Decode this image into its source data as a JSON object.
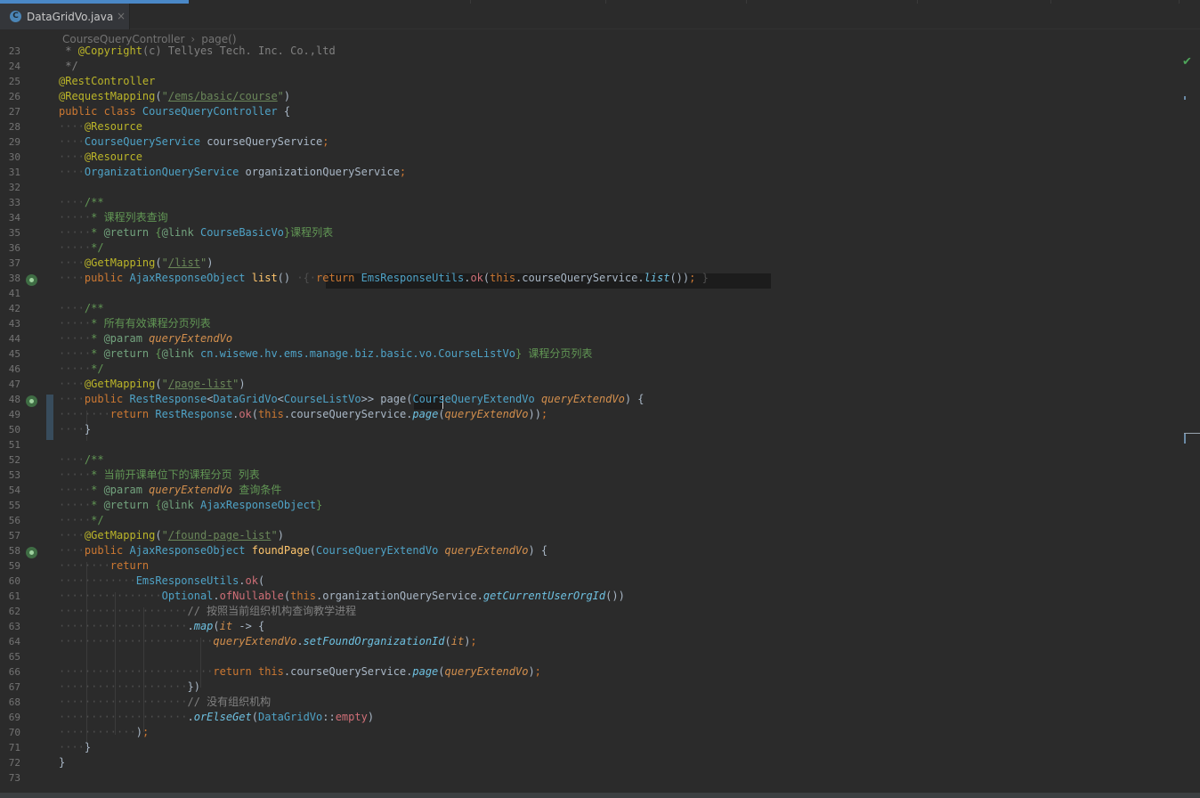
{
  "tab": {
    "icon_letter": "C",
    "filename": "DataGridVo.java",
    "close_glyph": "×"
  },
  "breadcrumb": {
    "class_name": "CourseQueryController",
    "separator": "›",
    "method_name": "page()"
  },
  "inspection_status": "✔",
  "line_numbers": [
    "23",
    "24",
    "25",
    "26",
    "27",
    "28",
    "29",
    "30",
    "31",
    "32",
    "33",
    "34",
    "35",
    "36",
    "37",
    "38",
    "41",
    "42",
    "43",
    "44",
    "45",
    "46",
    "47",
    "48",
    "49",
    "50",
    "51",
    "52",
    "53",
    "54",
    "55",
    "56",
    "57",
    "58",
    "59",
    "60",
    "61",
    "62",
    "63",
    "64",
    "65",
    "66",
    "67",
    "68",
    "69",
    "70",
    "71",
    "72",
    "73"
  ],
  "code_lines": [
    [
      [
        "c",
        " * "
      ],
      [
        "a",
        "@Copyright"
      ],
      [
        "c",
        "(c) Tellyes Tech. Inc. Co.,ltd"
      ]
    ],
    [
      [
        "c",
        " */"
      ]
    ],
    [
      [
        "a",
        "@RestController"
      ]
    ],
    [
      [
        "a",
        "@RequestMapping"
      ],
      [
        "br",
        "("
      ],
      [
        "s",
        "\""
      ],
      [
        "su",
        "/ems/basic/course"
      ],
      [
        "s",
        "\""
      ],
      [
        "br",
        ")"
      ]
    ],
    [
      [
        "k",
        "public class "
      ],
      [
        "t",
        "CourseQueryController "
      ],
      [
        "br",
        "{"
      ]
    ],
    [
      [
        "ws",
        "····"
      ],
      [
        "a",
        "@Resource"
      ]
    ],
    [
      [
        "ws",
        "····"
      ],
      [
        "t",
        "CourseQueryService "
      ],
      [
        "br",
        "courseQueryService"
      ],
      [
        "k",
        ";"
      ]
    ],
    [
      [
        "ws",
        "····"
      ],
      [
        "a",
        "@Resource"
      ]
    ],
    [
      [
        "ws",
        "····"
      ],
      [
        "t",
        "OrganizationQueryService "
      ],
      [
        "br",
        "organizationQueryService"
      ],
      [
        "k",
        ";"
      ]
    ],
    [],
    [
      [
        "ws",
        "····"
      ],
      [
        "dt",
        "/**"
      ]
    ],
    [
      [
        "ws",
        "·····"
      ],
      [
        "dt",
        "* 课程列表查询"
      ]
    ],
    [
      [
        "ws",
        "·····"
      ],
      [
        "dt",
        "* "
      ],
      [
        "dl",
        "@return "
      ],
      [
        "dt",
        "{"
      ],
      [
        "dl",
        "@link "
      ],
      [
        "t",
        "CourseBasicVo"
      ],
      [
        "dt",
        "}课程列表"
      ]
    ],
    [
      [
        "ws",
        "·····"
      ],
      [
        "dt",
        "*/"
      ]
    ],
    [
      [
        "ws",
        "····"
      ],
      [
        "a",
        "@GetMapping"
      ],
      [
        "br",
        "("
      ],
      [
        "s",
        "\""
      ],
      [
        "su",
        "/list"
      ],
      [
        "s",
        "\""
      ],
      [
        "br",
        ")"
      ]
    ],
    [
      [
        "ws",
        "····"
      ],
      [
        "k",
        "public "
      ],
      [
        "t",
        "AjaxResponseObject "
      ],
      [
        "m",
        "list"
      ],
      [
        "br",
        "() "
      ],
      [
        "ws",
        "·{·"
      ],
      [
        "k",
        "return "
      ],
      [
        "t",
        "EmsResponseUtils"
      ],
      [
        "br",
        "."
      ],
      [
        "o",
        "ok"
      ],
      [
        "br",
        "("
      ],
      [
        "k",
        "this"
      ],
      [
        "br",
        ".courseQueryService."
      ],
      [
        "mi",
        "list"
      ],
      [
        "br",
        "())"
      ],
      [
        "k",
        ";"
      ],
      [
        "ws",
        " }"
      ]
    ],
    [],
    [
      [
        "ws",
        "····"
      ],
      [
        "dt",
        "/**"
      ]
    ],
    [
      [
        "ws",
        "·····"
      ],
      [
        "dt",
        "* 所有有效课程分页列表"
      ]
    ],
    [
      [
        "ws",
        "·····"
      ],
      [
        "dt",
        "* "
      ],
      [
        "dl",
        "@param "
      ],
      [
        "p",
        "queryExtendVo"
      ]
    ],
    [
      [
        "ws",
        "·····"
      ],
      [
        "dt",
        "* "
      ],
      [
        "dl",
        "@return "
      ],
      [
        "dt",
        "{"
      ],
      [
        "dl",
        "@link "
      ],
      [
        "t",
        "cn.wisewe.hv.ems.manage.biz.basic.vo.CourseListVo"
      ],
      [
        "dt",
        "} 课程分页列表"
      ]
    ],
    [
      [
        "ws",
        "·····"
      ],
      [
        "dt",
        "*/"
      ]
    ],
    [
      [
        "ws",
        "····"
      ],
      [
        "a",
        "@GetMapping"
      ],
      [
        "br",
        "("
      ],
      [
        "s",
        "\""
      ],
      [
        "su",
        "/page-list"
      ],
      [
        "s",
        "\""
      ],
      [
        "br",
        ")"
      ]
    ],
    [
      [
        "ws",
        "····"
      ],
      [
        "k",
        "public "
      ],
      [
        "t",
        "RestResponse"
      ],
      [
        "br",
        "<"
      ],
      [
        "t",
        "DataGridVo"
      ],
      [
        "br",
        "<"
      ],
      [
        "t",
        "CourseListVo"
      ],
      [
        "br",
        ">> "
      ],
      [
        "br",
        "page"
      ],
      [
        "br",
        "("
      ],
      [
        "t",
        "CourseQueryExtendVo "
      ],
      [
        "p",
        "queryExtendVo"
      ],
      [
        "br",
        ") {"
      ]
    ],
    [
      [
        "ws",
        "········"
      ],
      [
        "k",
        "return "
      ],
      [
        "t",
        "RestResponse"
      ],
      [
        "br",
        "."
      ],
      [
        "o",
        "ok"
      ],
      [
        "br",
        "("
      ],
      [
        "k",
        "this"
      ],
      [
        "br",
        ".courseQueryService."
      ],
      [
        "mi",
        "page"
      ],
      [
        "br",
        "("
      ],
      [
        "p",
        "queryExtendVo"
      ],
      [
        "br",
        "))"
      ],
      [
        "k",
        ";"
      ]
    ],
    [
      [
        "ws",
        "····"
      ],
      [
        "br",
        "}"
      ]
    ],
    [],
    [
      [
        "ws",
        "····"
      ],
      [
        "dt",
        "/**"
      ]
    ],
    [
      [
        "ws",
        "·····"
      ],
      [
        "dt",
        "* 当前开课单位下的课程分页 列表"
      ]
    ],
    [
      [
        "ws",
        "·····"
      ],
      [
        "dt",
        "* "
      ],
      [
        "dl",
        "@param "
      ],
      [
        "p",
        "queryExtendVo "
      ],
      [
        "dt",
        "查询条件"
      ]
    ],
    [
      [
        "ws",
        "·····"
      ],
      [
        "dt",
        "* "
      ],
      [
        "dl",
        "@return "
      ],
      [
        "dt",
        "{"
      ],
      [
        "dl",
        "@link "
      ],
      [
        "t",
        "AjaxResponseObject"
      ],
      [
        "dt",
        "}"
      ]
    ],
    [
      [
        "ws",
        "·····"
      ],
      [
        "dt",
        "*/"
      ]
    ],
    [
      [
        "ws",
        "····"
      ],
      [
        "a",
        "@GetMapping"
      ],
      [
        "br",
        "("
      ],
      [
        "s",
        "\""
      ],
      [
        "su",
        "/found-page-list"
      ],
      [
        "s",
        "\""
      ],
      [
        "br",
        ")"
      ]
    ],
    [
      [
        "ws",
        "····"
      ],
      [
        "k",
        "public "
      ],
      [
        "t",
        "AjaxResponseObject "
      ],
      [
        "m",
        "foundPage"
      ],
      [
        "br",
        "("
      ],
      [
        "t",
        "CourseQueryExtendVo "
      ],
      [
        "p",
        "queryExtendVo"
      ],
      [
        "br",
        ") {"
      ]
    ],
    [
      [
        "ws",
        "········"
      ],
      [
        "k",
        "return"
      ]
    ],
    [
      [
        "ws",
        "············"
      ],
      [
        "t",
        "EmsResponseUtils"
      ],
      [
        "br",
        "."
      ],
      [
        "o",
        "ok"
      ],
      [
        "br",
        "("
      ]
    ],
    [
      [
        "ws",
        "················"
      ],
      [
        "t",
        "Optional"
      ],
      [
        "br",
        "."
      ],
      [
        "o",
        "ofNullable"
      ],
      [
        "br",
        "("
      ],
      [
        "k",
        "this"
      ],
      [
        "br",
        ".organizationQueryService."
      ],
      [
        "mi",
        "getCurrentUserOrgId"
      ],
      [
        "br",
        "())"
      ]
    ],
    [
      [
        "ws",
        "····················"
      ],
      [
        "c",
        "// 按照当前组织机构查询教学进程"
      ]
    ],
    [
      [
        "ws",
        "····················"
      ],
      [
        "br",
        "."
      ],
      [
        "mi",
        "map"
      ],
      [
        "br",
        "("
      ],
      [
        "p",
        "it "
      ],
      [
        "br",
        "-> {"
      ]
    ],
    [
      [
        "ws",
        "························"
      ],
      [
        "p",
        "queryExtendVo"
      ],
      [
        "br",
        "."
      ],
      [
        "mi",
        "setFoundOrganizationId"
      ],
      [
        "br",
        "("
      ],
      [
        "p",
        "it"
      ],
      [
        "br",
        ")"
      ],
      [
        "k",
        ";"
      ]
    ],
    [],
    [
      [
        "ws",
        "························"
      ],
      [
        "k",
        "return this"
      ],
      [
        "br",
        ".courseQueryService."
      ],
      [
        "mi",
        "page"
      ],
      [
        "br",
        "("
      ],
      [
        "p",
        "queryExtendVo"
      ],
      [
        "br",
        ")"
      ],
      [
        "k",
        ";"
      ]
    ],
    [
      [
        "ws",
        "····················"
      ],
      [
        "br",
        "})"
      ]
    ],
    [
      [
        "ws",
        "····················"
      ],
      [
        "c",
        "// 没有组织机构"
      ]
    ],
    [
      [
        "ws",
        "····················"
      ],
      [
        "br",
        "."
      ],
      [
        "mi",
        "orElseGet"
      ],
      [
        "br",
        "("
      ],
      [
        "t",
        "DataGridVo"
      ],
      [
        "br",
        "::"
      ],
      [
        "o",
        "empty"
      ],
      [
        "br",
        ")"
      ]
    ],
    [
      [
        "ws",
        "············"
      ],
      [
        "br",
        ")"
      ],
      [
        "k",
        ";"
      ]
    ],
    [
      [
        "ws",
        "····"
      ],
      [
        "br",
        "}"
      ]
    ],
    [
      [
        "br",
        "}"
      ]
    ],
    []
  ]
}
